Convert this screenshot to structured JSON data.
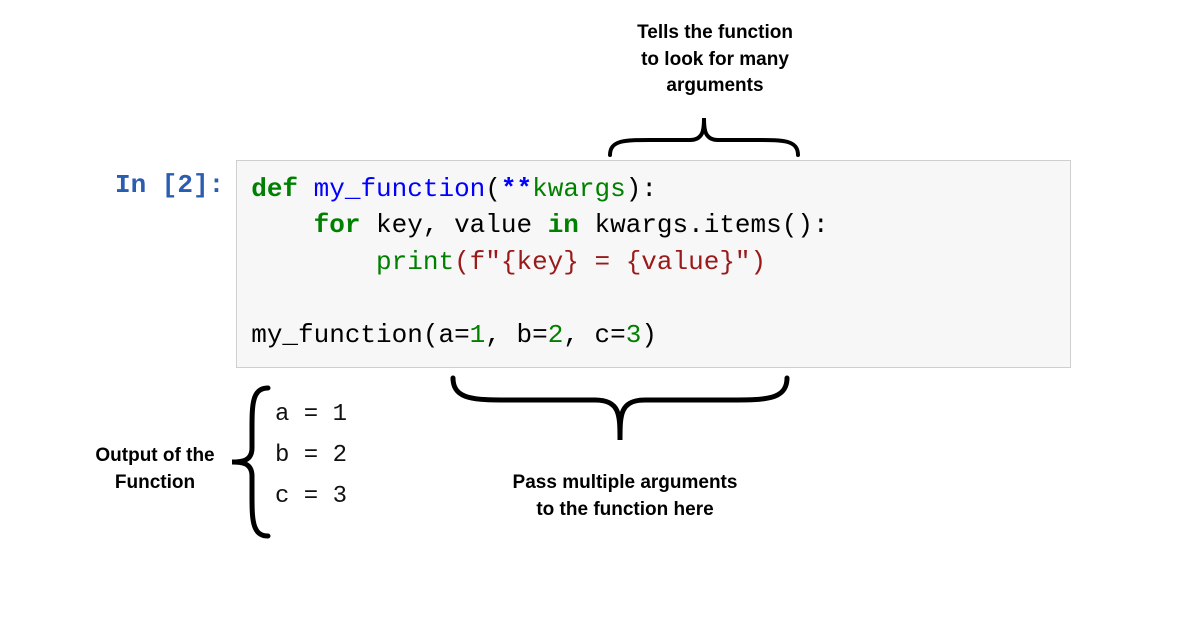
{
  "annotations": {
    "top": "Tells the function\nto look for many\narguments",
    "left": "Output of the\nFunction",
    "bottom": "Pass multiple arguments\nto the function here"
  },
  "prompt": "In [2]:",
  "code": {
    "def": "def",
    "fn_name": "my_function",
    "stars": "**",
    "kwargs": "kwargs",
    "colon1": "):",
    "for": "for",
    "loop_vars": " key, value ",
    "in": "in",
    "iter": " kwargs.items():",
    "indent2": "        ",
    "print": "print",
    "str_open": "(f\"",
    "interp1": "{key}",
    "str_mid": " = ",
    "interp2": "{value}",
    "str_close": "\")",
    "blank": " ",
    "call_fn": "my_function",
    "call_open": "(a=",
    "n1": "1",
    "sep1": ", b=",
    "n2": "2",
    "sep2": ", c=",
    "n3": "3",
    "call_close": ")"
  },
  "output": {
    "line1": "a = 1",
    "line2": "b = 2",
    "line3": "c = 3"
  }
}
